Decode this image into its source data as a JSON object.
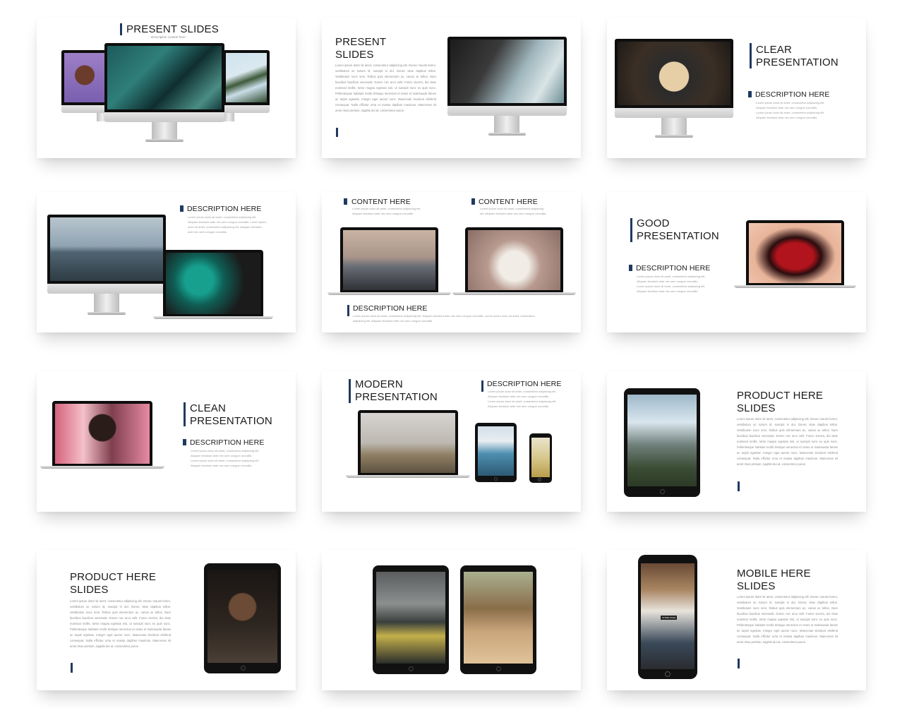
{
  "slides": [
    {
      "title": "PRESENT SLIDES",
      "subtitle": "Description content here"
    },
    {
      "title_line1": "PRESENT",
      "title_line2": "SLIDES",
      "body": "Lorem ipsum dolor sit amet, consectetur adipiscing elit. Donec mauris lorem, vestibulum ac rutrum id, suscipit in dui. Donec vitae dapibus tellus. Vestibulum nunc sem, finibus quis elementum ac, varius ac tellus. Nam faucibus faucibus venenatis. Donec nec arcu velit. Fusce viverra, dui vitae euismod mollis, tortor magna egestas nisi, ut suscipit nunc ex quis nunc. Pellentesque habitant morbi tristique senectus et netus et malesuada fames ac turpis egestas. Integer eget auctor nunc. Maecenas tincidunt eleifend consequat. Nulla efficitur urna et massa dapibus maximus. Maecenas sit amet risus pretium, sagittis dui at, consectetur purus."
    },
    {
      "title_line1": "CLEAR",
      "title_line2": "PRESENTATION",
      "desc_heading": "DESCRIPTION HERE",
      "desc": "Lorem ipsum dolor sit amet, consectetur adipiscing elit. Aliquam tincidunt ante nec sem congue convallis. Lorem ipsum dolor sit amet, consectetur adipiscing elit. Aliquam tincidunt ante nec sem congue convallis."
    },
    {
      "desc_heading": "DESCRIPTION HERE",
      "desc": "Lorem ipsum dolor sit amet, consectetur adipiscing elit. Aliquam tincidunt ante nec sem congue convallis. Lorem ipsum dolor sit amet, consectetur adipiscing elit. Aliquam tincidunt ante nec sem congue convallis."
    },
    {
      "content1_heading": "CONTENT HERE",
      "content1": "Lorem ipsum dolor sit amet, consectetur adipiscing elit. Aliquam tincidunt ante nec sem congue convallis.",
      "content2_heading": "CONTENT HERE",
      "content2": "Lorem ipsum dolor sit amet, consectetur adipiscing elit. Aliquam tincidunt ante nec sem congue convallis.",
      "desc_heading": "DESCRIPTION HERE",
      "desc": "Lorem ipsum dolor sit amet, consectetur adipiscing elit. Aliquam tincidunt ante nec sem congue convallis. Lorem ipsum dolor sit amet, consectetur adipiscing elit. Aliquam tincidunt ante nec sem congue convallis."
    },
    {
      "title_line1": "GOOD",
      "title_line2": "PRESENTATION",
      "desc_heading": "DESCRIPTION HERE",
      "desc": "Lorem ipsum dolor sit amet, consectetur adipiscing elit. Aliquam tincidunt ante nec sem congue convallis. Lorem ipsum dolor sit amet, consectetur adipiscing elit. Aliquam tincidunt ante nec sem congue convallis."
    },
    {
      "title_line1": "CLEAN",
      "title_line2": "PRESENTATION",
      "desc_heading": "DESCRIPTION HERE",
      "desc": "Lorem ipsum dolor sit amet, consectetur adipiscing elit. Aliquam tincidunt ante nec sem congue convallis. Lorem ipsum dolor sit amet, consectetur adipiscing elit. Aliquam tincidunt ante nec sem congue convallis."
    },
    {
      "title_line1": "MODERN",
      "title_line2": "PRESENTATION",
      "desc_heading": "DESCRIPTION HERE",
      "desc": "Lorem ipsum dolor sit amet, consectetur adipiscing elit. Aliquam tincidunt ante nec sem congue convallis. Lorem ipsum dolor sit amet, consectetur adipiscing elit. Aliquam tincidunt ante nec sem congue convallis."
    },
    {
      "title_line1": "PRODUCT HERE",
      "title_line2": "SLIDES",
      "body": "Lorem ipsum dolor sit amet, consectetur adipiscing elit. Donec mauris lorem, vestibulum ac rutrum id, suscipit in dui. Donec vitae dapibus tellus. Vestibulum nunc sem, finibus quis elementum ac, varius ac tellus. Nam faucibus faucibus venenatis. Donec nec arcu velit. Fusce viverra, dui vitae euismod mollis, tortor magna egestas nisi, ut suscipit nunc ex quis nunc. Pellentesque habitant morbi tristique senectus et netus et malesuada fames ac turpis egestas. Integer eget auctor nunc. Maecenas tincidunt eleifend consequat. Nulla efficitur urna et massa dapibus maximus. Maecenas sit amet risus pretium, sagittis dui at, consectetur purus."
    },
    {
      "title_line1": "PRODUCT HERE",
      "title_line2": "SLIDES",
      "body": "Lorem ipsum dolor sit amet, consectetur adipiscing elit. Donec mauris lorem, vestibulum ac rutrum id, suscipit in dui. Donec vitae dapibus tellus. Vestibulum nunc sem, finibus quis elementum ac, varius ac tellus. Nam faucibus faucibus venenatis. Donec nec arcu velit. Fusce viverra, dui vitae euismod mollis, tortor magna egestas nisi, ut suscipit nunc ex quis nunc. Pellentesque habitant morbi tristique senectus et netus et malesuada fames ac turpis egestas. Integer eget auctor nunc. Maecenas tincidunt eleifend consequat. Nulla efficitur urna et massa dapibus maximus. Maecenas sit amet risus pretium, sagittis dui at, consectetur purus."
    },
    {},
    {
      "title_line1": "MOBILE HERE",
      "title_line2": "SLIDES",
      "body": "Lorem ipsum dolor sit amet, consectetur adipiscing elit. Donec mauris lorem, vestibulum ac rutrum id, suscipit in dui. Donec vitae dapibus tellus. Vestibulum nunc sem, finibus quis elementum ac, varius ac tellus. Nam faucibus faucibus venenatis. Donec nec arcu velit. Fusce viverra, dui vitae euismod mollis, tortor magna egestas nisi, ut suscipit nunc ex quis nunc. Pellentesque habitant morbi tristique senectus et netus et malesuada fames ac turpis egestas. Integer eget auctor nunc. Maecenas tincidunt eleifend consequat. Nulla efficitur urna et massa dapibus maximus. Maecenas sit amet risus pretium, sagittis dui at, consectetur purus.",
      "store_sign": "STORE PAGE"
    }
  ],
  "colors": {
    "accent_bar": "#1f3a5f",
    "title_text": "#1a1a1a",
    "body_text": "#8c8c8c"
  }
}
